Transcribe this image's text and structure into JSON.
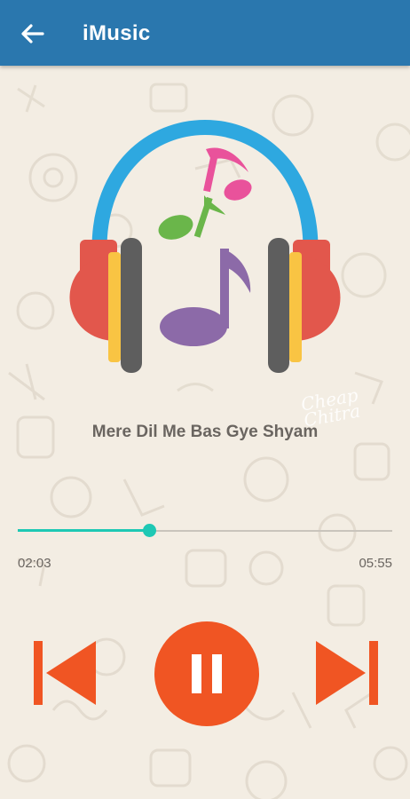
{
  "app_bar": {
    "title": "iMusic",
    "back_icon": "arrow-left-icon",
    "color": "#2a77ae"
  },
  "artwork": {
    "icon": "headphones-music-notes-icon",
    "watermark": "Cheap Chitra"
  },
  "now_playing": {
    "song_title": "Mere Dil Me Bas Gye Shyam",
    "current_time": "02:03",
    "duration": "05:55",
    "progress": 0.35,
    "accent_color": "#1ec8b4"
  },
  "controls": {
    "previous_icon": "skip-previous-icon",
    "pause_icon": "pause-icon",
    "next_icon": "skip-next-icon",
    "color": "#f05523"
  }
}
